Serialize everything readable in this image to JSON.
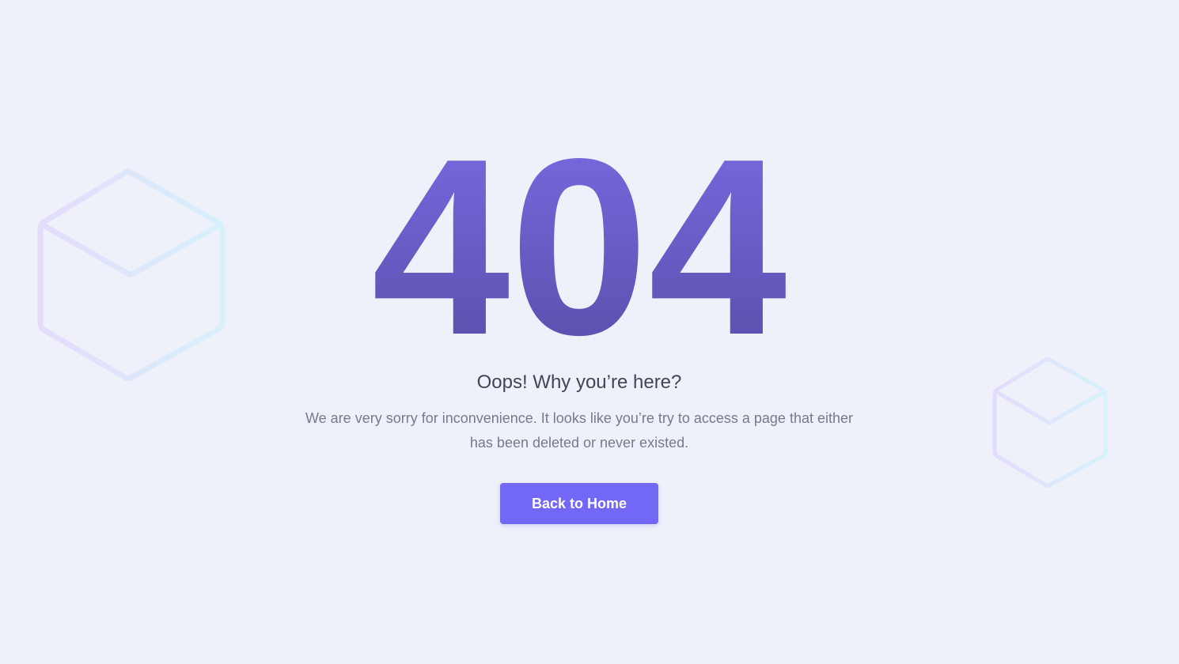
{
  "error": {
    "code": "404",
    "headline": "Oops! Why you’re here?",
    "message": "We are very sorry for inconvenience. It looks like you’re try to access a page that either has been deleted or never existed.",
    "button_label": "Back to Home"
  },
  "colors": {
    "background": "#eef1f9",
    "code_gradient_top": "#7a6de6",
    "code_gradient_bottom": "#564ca4",
    "headline": "#3f4656",
    "message": "#747b8c",
    "button": "#7367f5",
    "cube_stroke_start": "#e3dcfb",
    "cube_stroke_end": "#d9f2fb"
  },
  "decorations": [
    "cube-icon",
    "cube-icon"
  ]
}
